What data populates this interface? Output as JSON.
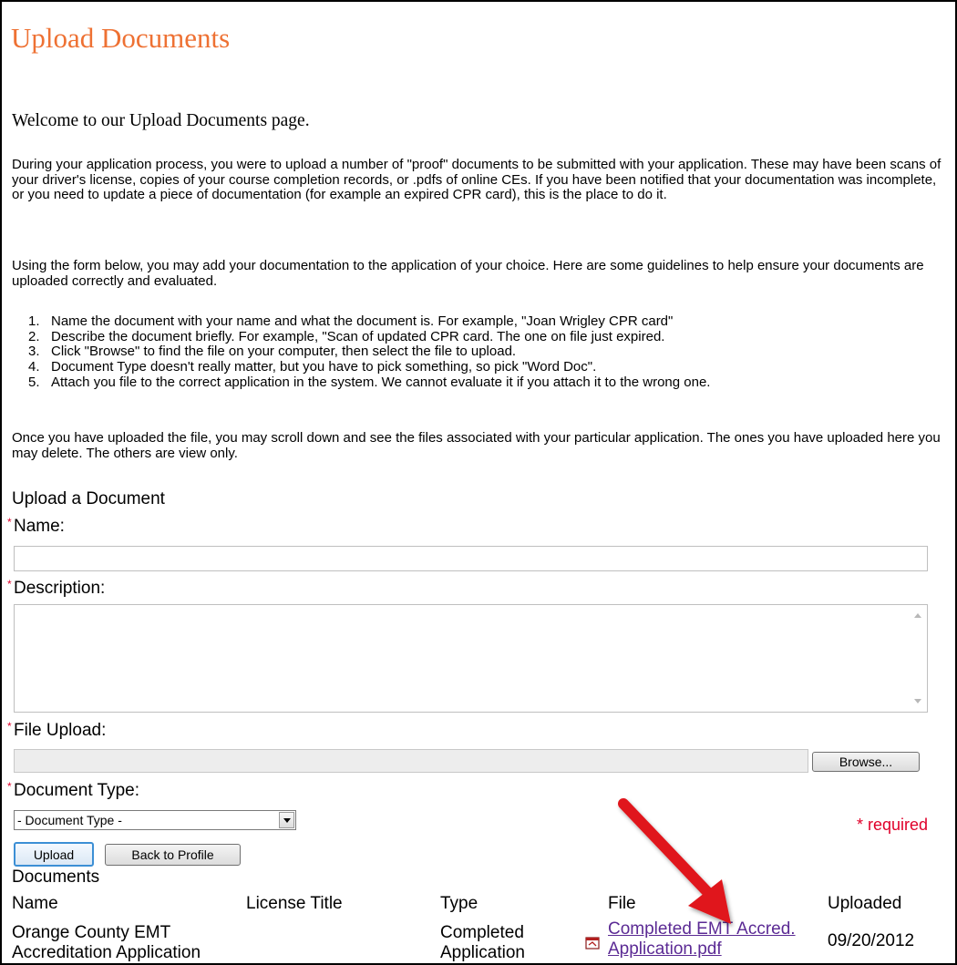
{
  "page": {
    "title": "Upload Documents",
    "welcome": "Welcome to our Upload Documents page.",
    "intro": "During your application process, you were to upload a number of \"proof\" documents to be submitted with your application. These may have been scans of your driver's license, copies of your course completion records, or .pdfs of online CEs. If you have been notified that your documentation was incomplete, or you need to update a piece of documentation (for example an expired CPR card), this is the place to do it.",
    "guidelines_intro": "Using the form below, you may add your documentation to the application of your choice. Here are some guidelines to help ensure your documents are uploaded correctly and evaluated.",
    "guidelines": [
      {
        "num": "1.",
        "text": "Name the document with your name and what the document is. For example, \"Joan Wrigley CPR card\""
      },
      {
        "num": "2.",
        "text": "Describe the document briefly. For example, \"Scan of updated CPR card. The one on file just expired."
      },
      {
        "num": "3.",
        "text": "Click \"Browse\" to find the file on your computer, then select the file to upload."
      },
      {
        "num": "4.",
        "text": "Document Type doesn't really matter, but you have to pick something, so pick \"Word Doc\"."
      },
      {
        "num": "5.",
        "text": "Attach you file to the correct application in the system. We cannot evaluate it if you attach it to the wrong one."
      }
    ],
    "outro": "Once you have uploaded the file, you may scroll down and see the files associated with your particular application. The ones you have uploaded here you may delete. The others are view only."
  },
  "form": {
    "heading": "Upload a Document",
    "required_mark": "*",
    "name_label": "Name:",
    "name_value": "",
    "description_label": "Description:",
    "description_value": "",
    "file_label": "File Upload:",
    "file_value": "",
    "browse_label": "Browse...",
    "doc_type_label": "Document Type:",
    "doc_type_selected": "- Document Type -",
    "required_note": "* required",
    "upload_label": "Upload",
    "back_label": "Back to Profile"
  },
  "documents": {
    "heading": "Documents",
    "columns": {
      "name": "Name",
      "license_title": "License Title",
      "type": "Type",
      "file": "File",
      "uploaded": "Uploaded"
    },
    "rows": [
      {
        "name": "Orange County EMT Accreditation Application",
        "license_title": "",
        "type": "Completed Application",
        "file": "Completed EMT Accred. Application.pdf",
        "uploaded": "09/20/2012"
      }
    ]
  },
  "colors": {
    "title": "#ee7133",
    "required": "#e0002a",
    "link": "#5b2a94",
    "annotation_arrow": "#e0191e"
  },
  "icons": {
    "file_icon": "pdf-file-icon",
    "annotation": "red-arrow-icon"
  }
}
